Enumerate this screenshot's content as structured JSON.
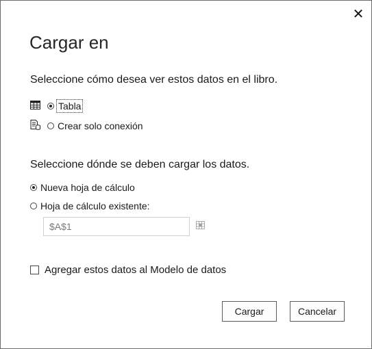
{
  "dialog": {
    "title": "Cargar en",
    "close_glyph": "✕"
  },
  "view_section": {
    "heading": "Seleccione cómo desea ver estos datos en el libro.",
    "options": [
      {
        "label": "Tabla",
        "selected": true,
        "icon": "table-icon"
      },
      {
        "label": "Crear solo conexión",
        "selected": false,
        "icon": "connection-icon"
      }
    ]
  },
  "load_section": {
    "heading": "Seleccione dónde se deben cargar los datos.",
    "options": [
      {
        "label": "Nueva hoja de cálculo",
        "selected": true
      },
      {
        "label": "Hoja de cálculo existente:",
        "selected": false
      }
    ],
    "cell_reference": "$A$1",
    "range_picker_icon": "range-select-icon"
  },
  "data_model": {
    "label": "Agregar estos datos al Modelo de datos",
    "checked": false
  },
  "buttons": {
    "load": "Cargar",
    "cancel": "Cancelar"
  }
}
